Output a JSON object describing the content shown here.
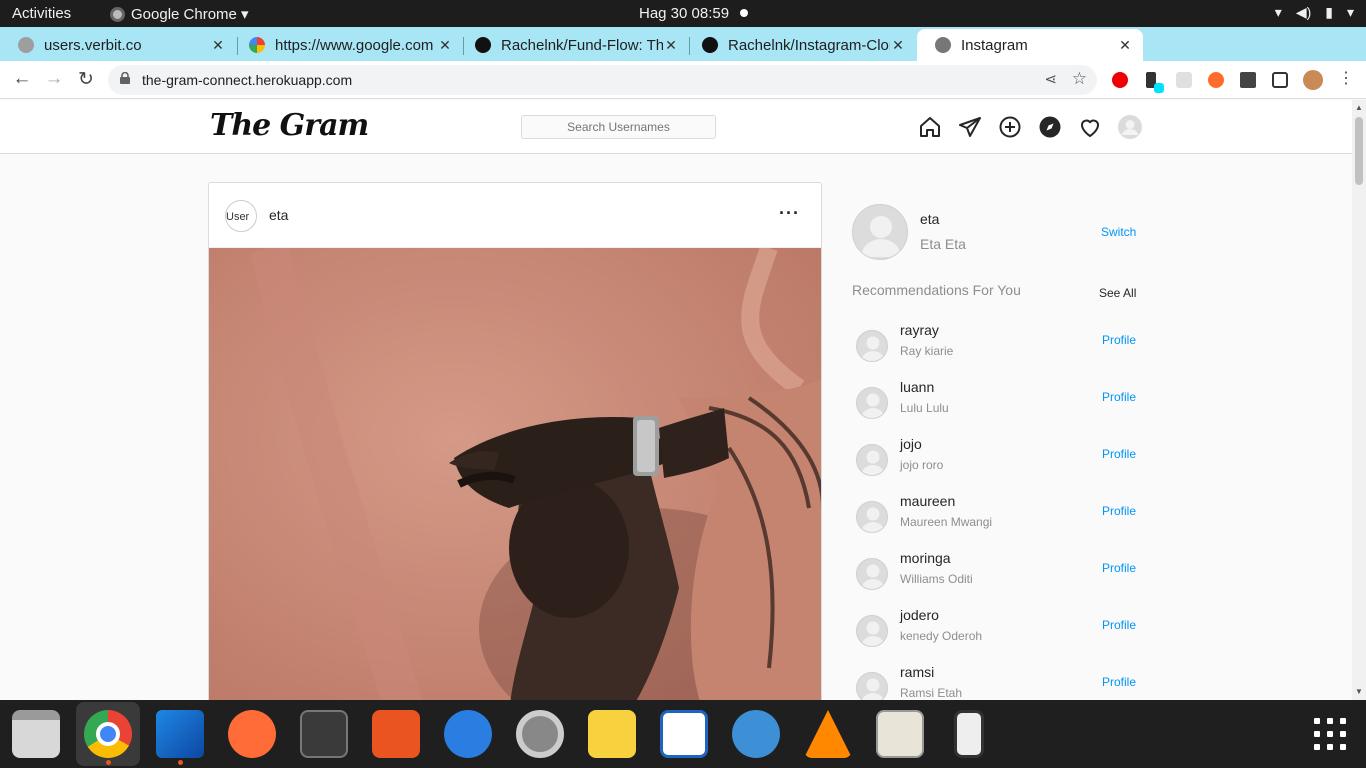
{
  "topbar": {
    "activities": "Activities",
    "app": "Google Chrome ▾",
    "clock": "Hag 30  08:59"
  },
  "tabs": [
    {
      "title": "users.verbit.co",
      "fav": "#9e9e9e"
    },
    {
      "title": "https://www.google.com",
      "fav": "#4285f4"
    },
    {
      "title": "Rachelnk/Fund-Flow: The",
      "fav": "#111111"
    },
    {
      "title": "Rachelnk/Instagram-Clone",
      "fav": "#111111"
    },
    {
      "title": "Instagram",
      "fav": "#777777"
    }
  ],
  "address": {
    "url": "the-gram-connect.herokuapp.com"
  },
  "header": {
    "logo": "The Gram",
    "search_placeholder": "Search Usernames"
  },
  "post": {
    "avatar_alt": "User",
    "username": "eta",
    "more": "···"
  },
  "sidebar": {
    "username": "eta",
    "full_name": "Eta Eta",
    "switch_label": "Switch",
    "recommendations_title": "Recommendations For You",
    "see_all": "See All",
    "recommendations": [
      {
        "username": "rayray",
        "name": "Ray kiarie",
        "action": "Profile"
      },
      {
        "username": "luann",
        "name": "Lulu Lulu",
        "action": "Profile"
      },
      {
        "username": "jojo",
        "name": "jojo roro",
        "action": "Profile"
      },
      {
        "username": "maureen",
        "name": "Maureen Mwangi",
        "action": "Profile"
      },
      {
        "username": "moringa",
        "name": "Williams Oditi",
        "action": "Profile"
      },
      {
        "username": "jodero",
        "name": "kenedy Oderoh",
        "action": "Profile"
      },
      {
        "username": "ramsi",
        "name": "Ramsi Etah",
        "action": "Profile"
      }
    ]
  },
  "colors": {
    "link": "#0095f6",
    "tabstrip": "#a8e6f5"
  },
  "dock": [
    "files",
    "chrome",
    "vscode",
    "postman",
    "terminal",
    "app-center",
    "help",
    "settings",
    "sticky-notes",
    "writer",
    "qbittorrent",
    "vlc",
    "sudoku",
    "device",
    "show-apps"
  ]
}
